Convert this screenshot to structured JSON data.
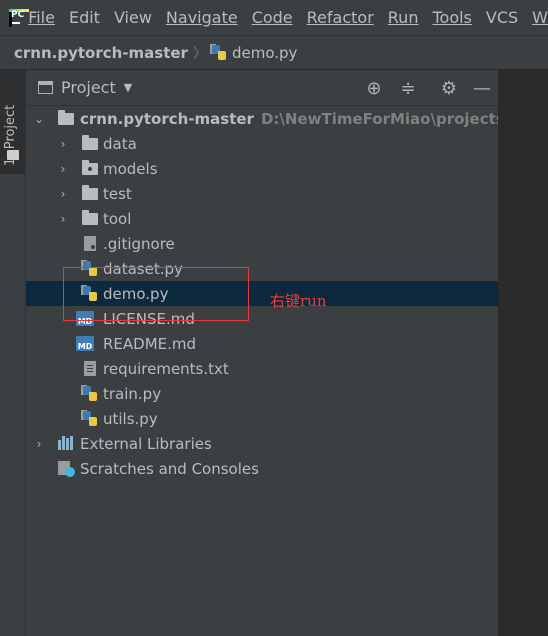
{
  "menubar": {
    "app_logo_text": "PC",
    "items": [
      {
        "label": "File",
        "mnemonic_index": 0
      },
      {
        "label": "Edit",
        "mnemonic_index": 0
      },
      {
        "label": "View",
        "mnemonic_index": 0
      },
      {
        "label": "Navigate",
        "mnemonic_index": 0
      },
      {
        "label": "Code",
        "mnemonic_index": 0
      },
      {
        "label": "Refactor",
        "mnemonic_index": 0
      },
      {
        "label": "Run",
        "mnemonic_index": 1
      },
      {
        "label": "Tools",
        "mnemonic_index": 0
      },
      {
        "label": "VCS",
        "mnemonic_index": 1
      },
      {
        "label": "W",
        "mnemonic_index": 0
      }
    ]
  },
  "breadcrumb": {
    "root": "crnn.pytorch-master",
    "file": "demo.py"
  },
  "side_tab": {
    "label": "1: Project"
  },
  "project_panel": {
    "title": "Project",
    "icons": [
      "locate-icon",
      "collapse-all-icon",
      "gear-icon",
      "minimize-icon"
    ]
  },
  "tree": {
    "root": {
      "label": "crnn.pytorch-master",
      "path": "D:\\NewTimeForMiao\\projects\\crnn"
    },
    "items": [
      {
        "label": "data",
        "type": "folder"
      },
      {
        "label": "models",
        "type": "package"
      },
      {
        "label": "test",
        "type": "folder"
      },
      {
        "label": "tool",
        "type": "folder"
      },
      {
        "label": ".gitignore",
        "type": "git"
      },
      {
        "label": "dataset.py",
        "type": "py"
      },
      {
        "label": "demo.py",
        "type": "py",
        "selected": true
      },
      {
        "label": "LICENSE.md",
        "type": "md"
      },
      {
        "label": "README.md",
        "type": "md"
      },
      {
        "label": "requirements.txt",
        "type": "txt"
      },
      {
        "label": "train.py",
        "type": "py"
      },
      {
        "label": "utils.py",
        "type": "py"
      }
    ],
    "external_libraries": "External Libraries",
    "scratches": "Scratches and Consoles"
  },
  "annotation": {
    "text": "右键run",
    "color": "#e23a3a"
  },
  "colors": {
    "selection": "#0d293e",
    "panel_bg": "#3c3f41",
    "editor_bg": "#2b2b2b"
  }
}
